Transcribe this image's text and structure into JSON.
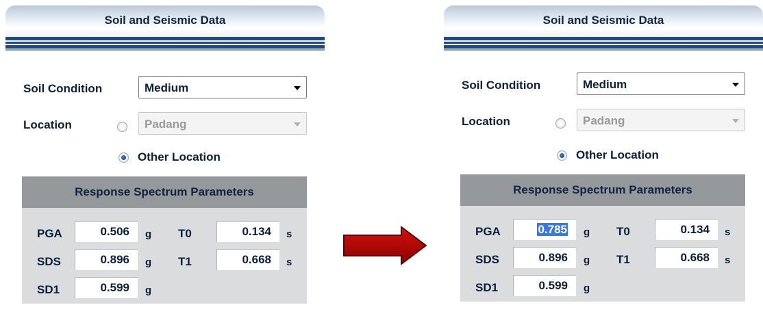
{
  "panels": [
    {
      "title": "Soil and Seismic Data",
      "soil_condition_label": "Soil Condition",
      "soil_condition_value": "Medium",
      "location_label": "Location",
      "location_dropdown_value": "Padang",
      "other_location_label": "Other Location",
      "rsp_title": "Response Spectrum Parameters",
      "params": {
        "pga_label": "PGA",
        "pga_value": "0.506",
        "pga_unit": "g",
        "sds_label": "SDS",
        "sds_value": "0.896",
        "sds_unit": "g",
        "sd1_label": "SD1",
        "sd1_value": "0.599",
        "sd1_unit": "g",
        "t0_label": "T0",
        "t0_value": "0.134",
        "t0_unit": "s",
        "t1_label": "T1",
        "t1_value": "0.668",
        "t1_unit": "s"
      }
    },
    {
      "title": "Soil and Seismic Data",
      "soil_condition_label": "Soil Condition",
      "soil_condition_value": "Medium",
      "location_label": "Location",
      "location_dropdown_value": "Padang",
      "other_location_label": "Other Location",
      "rsp_title": "Response Spectrum Parameters",
      "params": {
        "pga_label": "PGA",
        "pga_value": "0.785",
        "pga_unit": "g",
        "sds_label": "SDS",
        "sds_value": "0.896",
        "sds_unit": "g",
        "sd1_label": "SD1",
        "sd1_value": "0.599",
        "sd1_unit": "g",
        "t0_label": "T0",
        "t0_value": "0.134",
        "t0_unit": "s",
        "t1_label": "T1",
        "t1_value": "0.668",
        "t1_unit": "s"
      }
    }
  ],
  "colors": {
    "arrow": "#c00000",
    "header_stripe": "#1f4a7e",
    "selection": "#3b78d8"
  },
  "arrow_icon": "right-arrow-icon"
}
